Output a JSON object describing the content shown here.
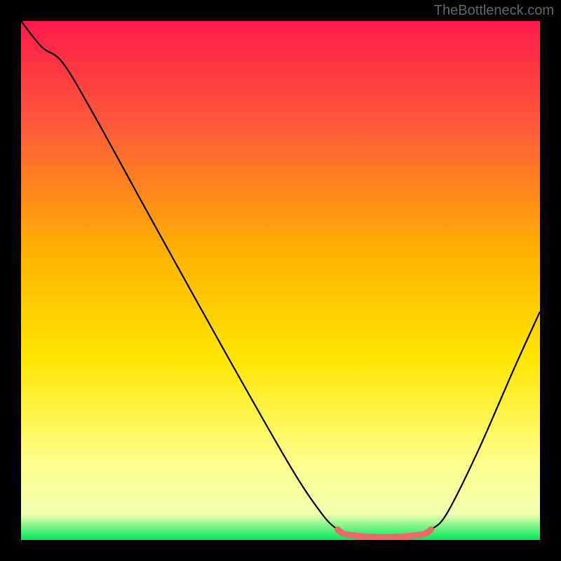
{
  "watermark": "TheBottleneck.com",
  "chart_data": {
    "type": "line",
    "title": "",
    "xlabel": "",
    "ylabel": "",
    "xlim": [
      0,
      100
    ],
    "ylim": [
      0,
      100
    ],
    "background_gradient": {
      "stops": [
        {
          "offset": 0,
          "color": "#ff1a4a"
        },
        {
          "offset": 20,
          "color": "#ff5a3a"
        },
        {
          "offset": 45,
          "color": "#ffb300"
        },
        {
          "offset": 65,
          "color": "#ffe600"
        },
        {
          "offset": 85,
          "color": "#ffff8a"
        },
        {
          "offset": 95,
          "color": "#f0ffb0"
        },
        {
          "offset": 100,
          "color": "#00e85a"
        }
      ]
    },
    "series": [
      {
        "name": "bottleneck-curve",
        "color": "#000000",
        "points": [
          {
            "x": 0,
            "y": 100
          },
          {
            "x": 4,
            "y": 95
          },
          {
            "x": 8,
            "y": 92
          },
          {
            "x": 14,
            "y": 82
          },
          {
            "x": 25,
            "y": 62
          },
          {
            "x": 40,
            "y": 35
          },
          {
            "x": 52,
            "y": 14
          },
          {
            "x": 58,
            "y": 5
          },
          {
            "x": 61,
            "y": 2
          },
          {
            "x": 63,
            "y": 1
          },
          {
            "x": 70,
            "y": 0.5
          },
          {
            "x": 77,
            "y": 1
          },
          {
            "x": 79,
            "y": 2
          },
          {
            "x": 82,
            "y": 5
          },
          {
            "x": 88,
            "y": 17
          },
          {
            "x": 95,
            "y": 33
          },
          {
            "x": 100,
            "y": 44
          }
        ]
      }
    ],
    "highlight": {
      "name": "optimal-range",
      "color": "#e86a6a",
      "points": [
        {
          "x": 61,
          "y": 2
        },
        {
          "x": 63,
          "y": 1
        },
        {
          "x": 70,
          "y": 0.5
        },
        {
          "x": 77,
          "y": 1
        },
        {
          "x": 79,
          "y": 2
        }
      ]
    }
  }
}
